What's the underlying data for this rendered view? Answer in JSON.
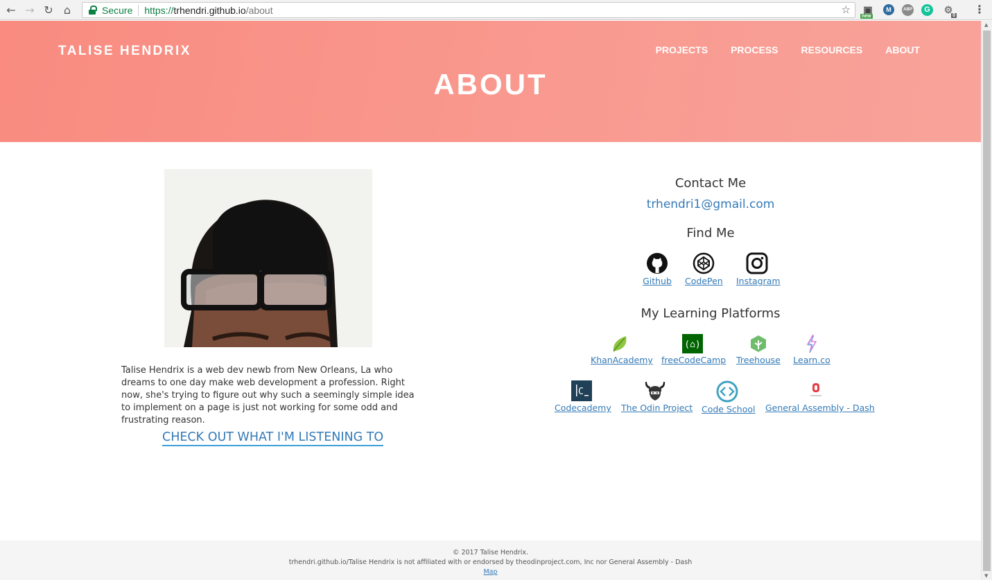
{
  "browser": {
    "secure_label": "Secure",
    "url_scheme": "https://",
    "url_host": "trhendri.github.io",
    "url_path": "/about",
    "ext_badge_new": "new",
    "ext_m": "M",
    "ext_abp": "ABP",
    "ext_g": "G",
    "ext_count": "0"
  },
  "header": {
    "brand": "TALISE HENDRIX",
    "nav": [
      "PROJECTS",
      "PROCESS",
      "RESOURCES",
      "ABOUT"
    ],
    "title": "ABOUT"
  },
  "about": {
    "bio": "Talise Hendrix is a web dev newb from New Orleans, La who dreams to one day make web development a profession. Right now, she's trying to figure out why such a seemingly simple idea to implement on a page is just not working for some odd and frustrating reason.",
    "listen_link": "CHECK OUT WHAT I'M LISTENING TO"
  },
  "contact": {
    "heading": "Contact Me",
    "email": "trhendri1@gmail.com",
    "find_heading": "Find Me",
    "social": [
      "Github",
      "CodePen",
      "Instagram"
    ],
    "learning_heading": "My Learning Platforms",
    "platforms_row1": [
      "KhanAcademy",
      "freeCodeCamp",
      "Treehouse",
      "Learn.co"
    ],
    "platforms_row2": [
      "Codecademy",
      "The Odin Project",
      "Code School",
      "General Assembly - Dash"
    ]
  },
  "footer": {
    "copyright": "© 2017 Talise Hendrix.",
    "disclaimer": "trhendri.github.io/Talise Hendrix is not affiliated with or endorsed by theodinproject.com, Inc nor General Assembly - Dash",
    "map": "Map"
  },
  "colors": {
    "hero_start": "#f98b80",
    "hero_end": "#f8a39a",
    "link": "#337ab7"
  }
}
